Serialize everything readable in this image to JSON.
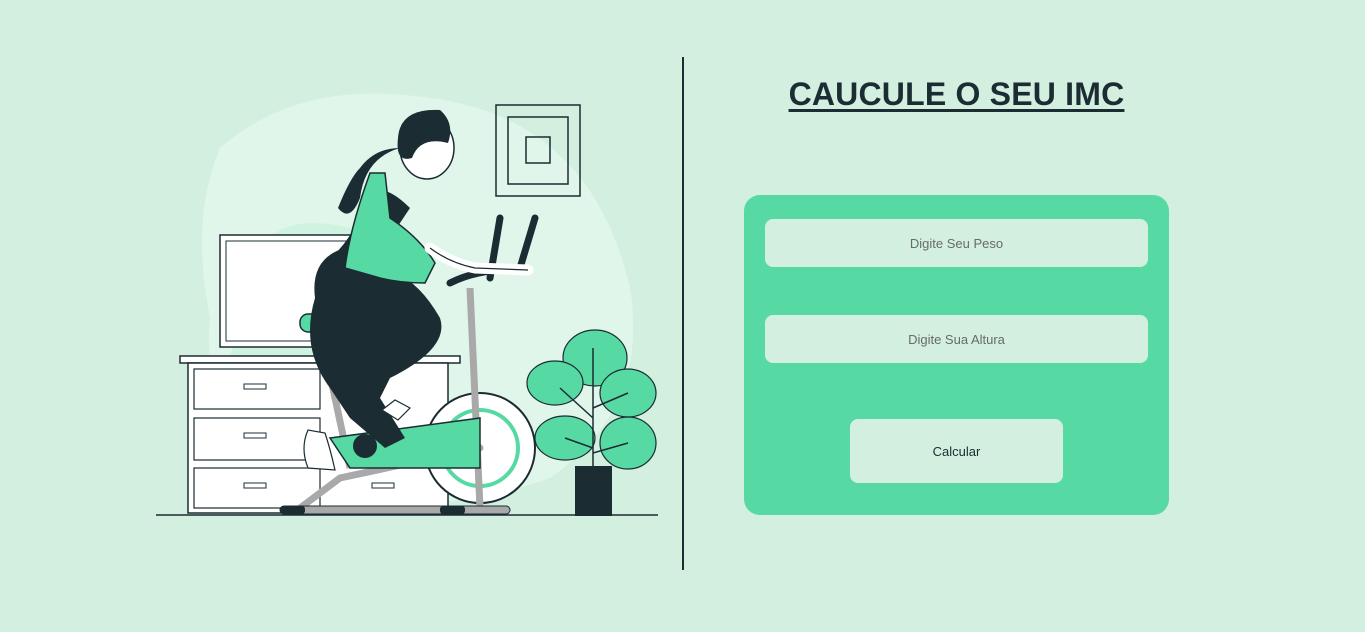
{
  "header": {
    "title": "CAUCULE O SEU IMC"
  },
  "form": {
    "peso_placeholder": "Digite Seu Peso",
    "altura_placeholder": "Digite Sua Altura",
    "calcular_label": "Calcular"
  },
  "illustration": {
    "icon": "woman-on-exercise-bike-illustration"
  },
  "colors": {
    "background": "#d2efe0",
    "accent": "#57d9a3",
    "dark": "#1b2c33"
  }
}
